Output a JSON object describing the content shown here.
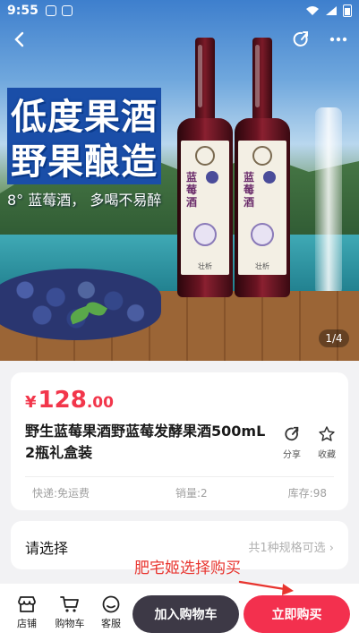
{
  "status_bar": {
    "time": "9:55"
  },
  "hero": {
    "headline_1": "低度果酒",
    "headline_2": "野果酿造",
    "tagline": "8° 蓝莓酒， 多喝不易醉",
    "bottle_name": "蓝莓酒",
    "bottle_brand": "壮析",
    "pager": "1/4"
  },
  "nav": {
    "back_icon": "chevron-left-icon",
    "share_icon": "share-icon",
    "more_icon": "more-icon"
  },
  "product": {
    "price_currency": "¥",
    "price_integer": "128",
    "price_decimal": ".00",
    "title": "野生蓝莓果酒野蓝莓发酵果酒500mL 2瓶礼盒装",
    "share_label": "分享",
    "favorite_label": "收藏",
    "shipping": "快递:免运费",
    "sales": "销量:2",
    "stock": "库存:98"
  },
  "spec": {
    "label": "请选择",
    "value": "共1种规格可选 ›"
  },
  "annotation": "肥宅姬选择购买",
  "bottom_bar": {
    "store_label": "店铺",
    "cart_label": "购物车",
    "service_label": "客服",
    "add_to_cart": "加入购物车",
    "buy_now": "立即购买"
  },
  "colors": {
    "accent": "#f3304e",
    "dark_button": "#3d3946",
    "price": "#f2364b"
  }
}
